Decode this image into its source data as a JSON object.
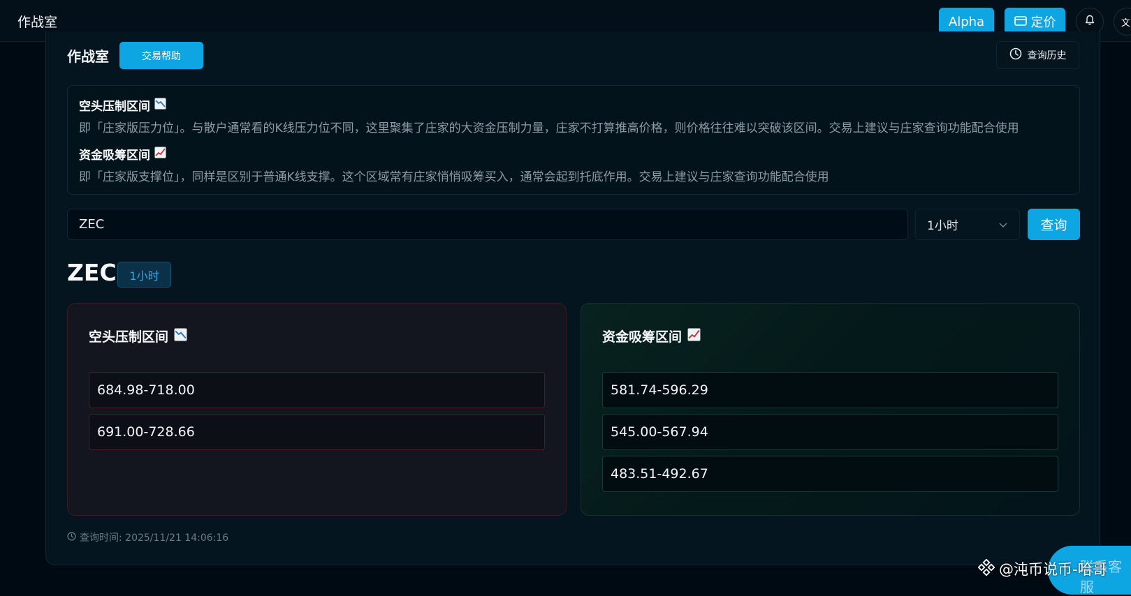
{
  "header": {
    "app_title": "作战室",
    "alpha_label": "Alpha",
    "pricing_label": "定价",
    "lang_label": "文"
  },
  "page": {
    "section_title": "作战室",
    "help_button": "交易帮助",
    "history_button": "查询历史"
  },
  "info": {
    "bear_heading": "空头压制区间",
    "bear_desc": "即「庄家版压力位」。与散户通常看的K线压力位不同，这里聚集了庄家的大资金压制力量，庄家不打算推高价格，则价格往往难以突破该区间。交易上建议与庄家查询功能配合使用",
    "bull_heading": "资金吸筹区间",
    "bull_desc": "即「庄家版支撑位」，同样是区别于普通K线支撑。这个区域常有庄家悄悄吸筹买入，通常会起到托底作用。交易上建议与庄家查询功能配合使用"
  },
  "search": {
    "value": "ZEC",
    "timeframe": "1小时",
    "query_button": "查询"
  },
  "result": {
    "symbol": "ZEC",
    "timeframe_badge": "1小时",
    "bear_panel": {
      "title": "空头压制区间",
      "zones": [
        "684.98-718.00",
        "691.00-728.66"
      ]
    },
    "bull_panel": {
      "title": "资金吸筹区间",
      "zones": [
        "581.74-596.29",
        "545.00-567.94",
        "483.51-492.67"
      ]
    },
    "query_time": "查询时间: 2025/11/21 14:06:16"
  },
  "overlay": {
    "watermark": "@沌币说币-哈哥",
    "float_label": "联系客服"
  },
  "colors": {
    "accent": "#0ea5e3",
    "background": "#000a13",
    "bear_border": "#4a1f27",
    "bull_border": "#173a36"
  }
}
